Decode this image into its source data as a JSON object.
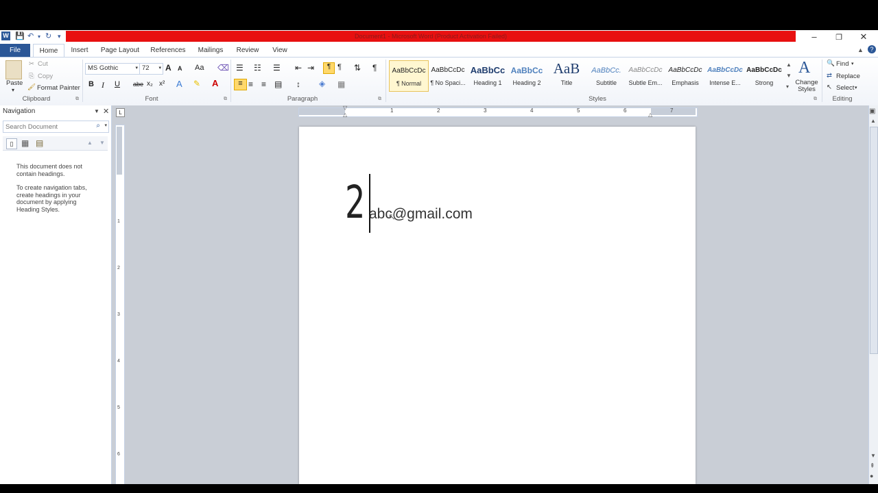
{
  "window": {
    "title": "Document1 - Microsoft Word (Product Activation Failed)",
    "app_icon": "W",
    "controls": [
      "–",
      "❐",
      "✕"
    ]
  },
  "tabs": {
    "file": "File",
    "items": [
      "Home",
      "Insert",
      "Page Layout",
      "References",
      "Mailings",
      "Review",
      "View"
    ],
    "active": "Home"
  },
  "ribbon": {
    "clipboard": {
      "label": "Clipboard",
      "paste": "Paste",
      "cut": "Cut",
      "copy": "Copy",
      "format_painter": "Format Painter"
    },
    "font": {
      "label": "Font",
      "font_name": "MS Gothic",
      "font_size": "72",
      "bold": "B",
      "italic": "I",
      "underline": "U",
      "strike": "abe",
      "subscript": "x₂",
      "superscript": "x²",
      "grow": "A",
      "shrink": "A",
      "change_case": "Aa"
    },
    "paragraph": {
      "label": "Paragraph",
      "pilcrow": "¶"
    },
    "styles": {
      "label": "Styles",
      "items": [
        {
          "preview": "AaBbCcDc",
          "name": "¶ Normal"
        },
        {
          "preview": "AaBbCcDc",
          "name": "¶ No Spaci..."
        },
        {
          "preview": "AaBbCc",
          "name": "Heading 1"
        },
        {
          "preview": "AaBbCc",
          "name": "Heading 2"
        },
        {
          "preview": "AaB",
          "name": "Title"
        },
        {
          "preview": "AaBbCc.",
          "name": "Subtitle"
        },
        {
          "preview": "AaBbCcDc",
          "name": "Subtle Em..."
        },
        {
          "preview": "AaBbCcDc",
          "name": "Emphasis"
        },
        {
          "preview": "AaBbCcDc",
          "name": "Intense E..."
        },
        {
          "preview": "AaBbCcDc",
          "name": "Strong"
        }
      ],
      "change_styles": "Change Styles"
    },
    "editing": {
      "label": "Editing",
      "find": "Find",
      "replace": "Replace",
      "select": "Select"
    }
  },
  "navigation": {
    "title": "Navigation",
    "search_placeholder": "Search Document",
    "message_1": "This document does not contain headings.",
    "message_2": "To create navigation tabs, create headings in your document by applying Heading Styles."
  },
  "document": {
    "big_char": "2",
    "text": "abc@gmail.com"
  },
  "ruler": {
    "numbers": [
      "1",
      "2",
      "3",
      "4",
      "5",
      "6",
      "7"
    ],
    "v_numbers": [
      "1",
      "2",
      "3",
      "4",
      "5",
      "6"
    ]
  },
  "colors": {
    "title_bar": "#e81010",
    "file_tab": "#2b5797",
    "accent": "#2b5797"
  }
}
